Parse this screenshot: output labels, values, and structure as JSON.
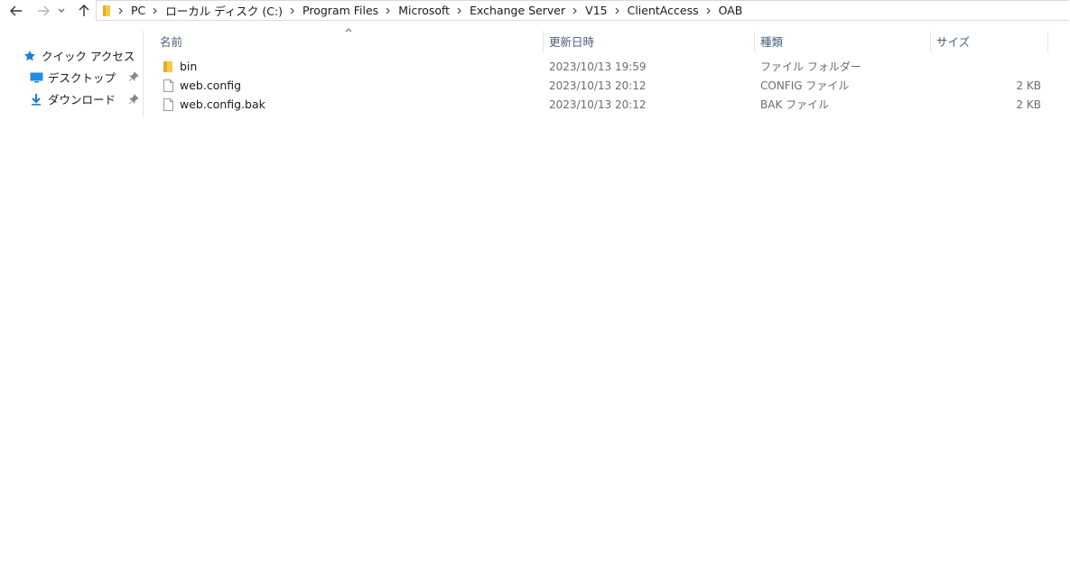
{
  "breadcrumbs": [
    "PC",
    "ローカル ディスク (C:)",
    "Program Files",
    "Microsoft",
    "Exchange Server",
    "V15",
    "ClientAccess",
    "OAB"
  ],
  "nav": {
    "items": [
      {
        "label": "クイック アクセス",
        "icon": "star-icon",
        "pinned": false
      },
      {
        "label": "デスクトップ",
        "icon": "desktop-icon",
        "pinned": true
      },
      {
        "label": "ダウンロード",
        "icon": "download-icon",
        "pinned": true
      }
    ]
  },
  "columns": {
    "name": "名前",
    "modified": "更新日時",
    "type": "種類",
    "size": "サイズ"
  },
  "files": [
    {
      "name": "bin",
      "modified": "2023/10/13 19:59",
      "type": "ファイル フォルダー",
      "size": "",
      "icon": "folder-icon"
    },
    {
      "name": "web.config",
      "modified": "2023/10/13 20:12",
      "type": "CONFIG ファイル",
      "size": "2 KB",
      "icon": "file-icon"
    },
    {
      "name": "web.config.bak",
      "modified": "2023/10/13 20:12",
      "type": "BAK ファイル",
      "size": "2 KB",
      "icon": "file-icon"
    }
  ],
  "colors": {
    "folder": "#f6c94a",
    "accent": "#1f7fd6",
    "header_text": "#4c607a"
  }
}
